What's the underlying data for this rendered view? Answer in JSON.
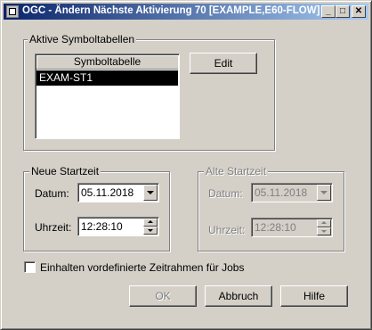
{
  "window": {
    "title": "OGC - Ändern Nächste Aktivierung 70 [EXAMPLE,E60-FLOW]",
    "minimize_glyph": "_",
    "maximize_glyph": "□",
    "close_glyph": "✕"
  },
  "symbol_tables": {
    "group_label": "Aktive Symboltabellen",
    "column_header": "Symboltabelle",
    "rows": [
      "EXAM-ST1"
    ],
    "selected_index": 0,
    "edit_button": "Edit"
  },
  "new_start": {
    "group_label": "Neue Startzeit",
    "date_label": "Datum:",
    "date_value": "05.11.2018",
    "time_label": "Uhrzeit:",
    "time_value": "12:28:10"
  },
  "old_start": {
    "group_label": "Alte Startzeit",
    "date_label": "Datum:",
    "date_value": "05.11.2018",
    "time_label": "Uhrzeit:",
    "time_value": "12:28:10"
  },
  "checkbox": {
    "label": "Einhalten vordefinierte Zeitrahmen für Jobs",
    "checked": false
  },
  "buttons": {
    "ok": "OK",
    "cancel": "Abbruch",
    "help": "Hilfe"
  },
  "colors": {
    "title_start": "#0a246a",
    "title_end": "#a6caf0",
    "selection": "#000000",
    "face": "#d4d0c8"
  }
}
